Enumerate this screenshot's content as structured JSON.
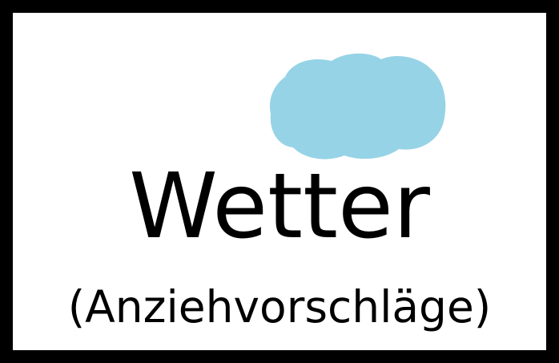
{
  "tile": {
    "title": "Wetter",
    "subtitle": "(Anziehvorschläge)",
    "icon": "cloud-icon",
    "colors": {
      "border": "#000000",
      "background": "#ffffff",
      "cloud": "#96d3e6",
      "text": "#000000"
    }
  }
}
